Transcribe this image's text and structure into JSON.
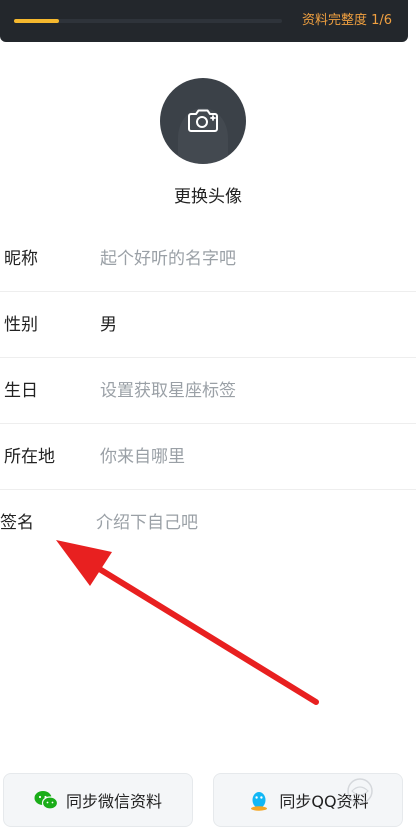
{
  "progress": {
    "text": "资料完整度 1/6",
    "fraction": 0.1667,
    "fill_color": "#f5b82e",
    "text_color": "#f0a040"
  },
  "avatar": {
    "label": "更换头像",
    "icon": "camera-plus-icon"
  },
  "form": {
    "rows": [
      {
        "label": "昵称",
        "value": "起个好听的名字吧",
        "state": "placeholder"
      },
      {
        "label": "性别",
        "value": "男",
        "state": "filled"
      },
      {
        "label": "生日",
        "value": "设置获取星座标签",
        "state": "placeholder"
      },
      {
        "label": "所在地",
        "value": "你来自哪里",
        "state": "placeholder"
      },
      {
        "label": "签名",
        "value": "介绍下自己吧",
        "state": "placeholder"
      }
    ]
  },
  "annotation": {
    "arrow_color": "#e82020"
  },
  "actions": {
    "wechat_label": "同步微信资料",
    "wechat_icon": "wechat-icon",
    "wechat_color": "#1aad19",
    "qq_label": "同步QQ资料",
    "qq_icon": "qq-icon",
    "qq_color": "#12b7f5"
  }
}
